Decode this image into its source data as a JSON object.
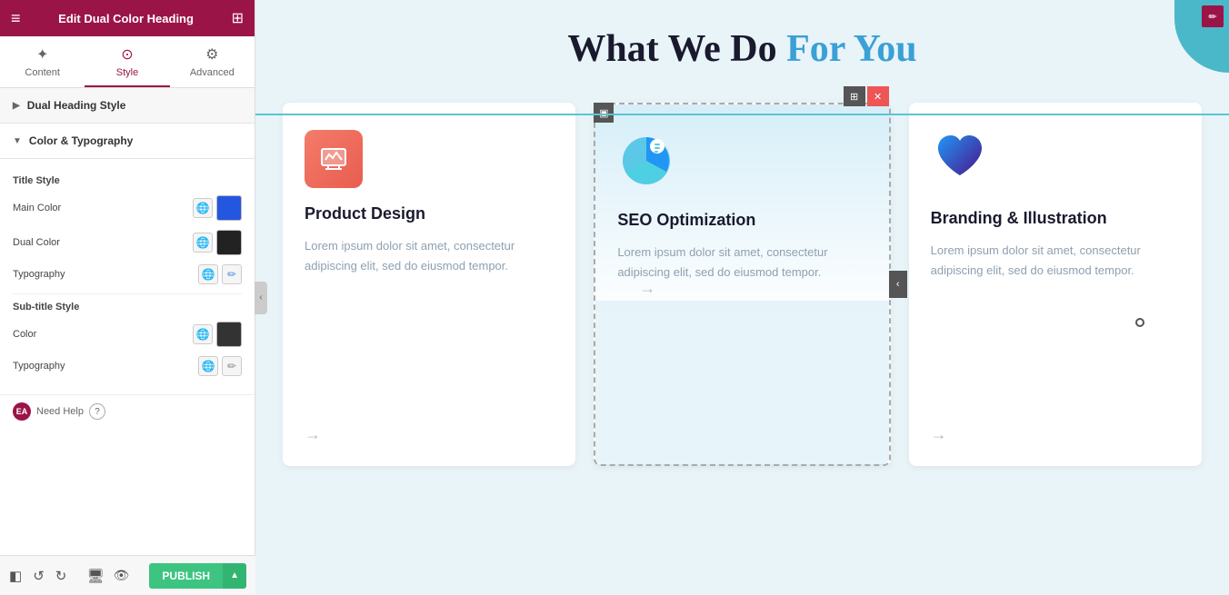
{
  "panel": {
    "topbar": {
      "title": "Edit Dual Color Heading",
      "hamburger": "≡",
      "grid": "⊞"
    },
    "tabs": [
      {
        "id": "content",
        "label": "Content",
        "icon": "✦",
        "active": false
      },
      {
        "id": "style",
        "label": "Style",
        "icon": "⊙",
        "active": true
      },
      {
        "id": "advanced",
        "label": "Advanced",
        "icon": "⚙",
        "active": false
      }
    ],
    "sections": {
      "dual_heading": {
        "label": "Dual Heading Style",
        "collapsed": true
      },
      "color_typography": {
        "label": "Color & Typography",
        "collapsed": false
      }
    },
    "title_style": {
      "label": "Title Style",
      "main_color": {
        "label": "Main Color",
        "color": "#2456e0"
      },
      "dual_color": {
        "label": "Dual Color",
        "color": "#222222"
      },
      "typography": {
        "label": "Typography"
      }
    },
    "subtitle_style": {
      "label": "Sub-title Style",
      "color": {
        "label": "Color",
        "color": "#333333"
      },
      "typography": {
        "label": "Typography"
      }
    },
    "need_help": {
      "badge": "EA",
      "label": "Need Help",
      "icon": "?"
    },
    "publish_btn": "PUBLISH"
  },
  "main": {
    "heading": {
      "part1": "What We Do ",
      "part2": "For You"
    },
    "cards": [
      {
        "id": "product-design",
        "icon_type": "product",
        "title": "Product Design",
        "text": "Lorem ipsum dolor sit amet, consectetur adipiscing elit, sed do eiusmod tempor.",
        "arrow": "→"
      },
      {
        "id": "seo-optimization",
        "icon_type": "seo",
        "title": "SEO Optimization",
        "text": "Lorem ipsum dolor sit amet, consectetur adipiscing elit, sed do eiusmod tempor.",
        "arrow": "→",
        "selected": true
      },
      {
        "id": "branding",
        "icon_type": "brand",
        "title": "Branding & Illustration",
        "text": "Lorem ipsum dolor sit amet, consectetur adipiscing elit, sed do eiusmod tempor.",
        "arrow": "→"
      }
    ]
  },
  "colors": {
    "main_color_swatch": "#2456e0",
    "dual_color_swatch": "#222222",
    "subtitle_color_swatch": "#444444",
    "accent": "#9b1448",
    "publish_green": "#3cc480"
  }
}
